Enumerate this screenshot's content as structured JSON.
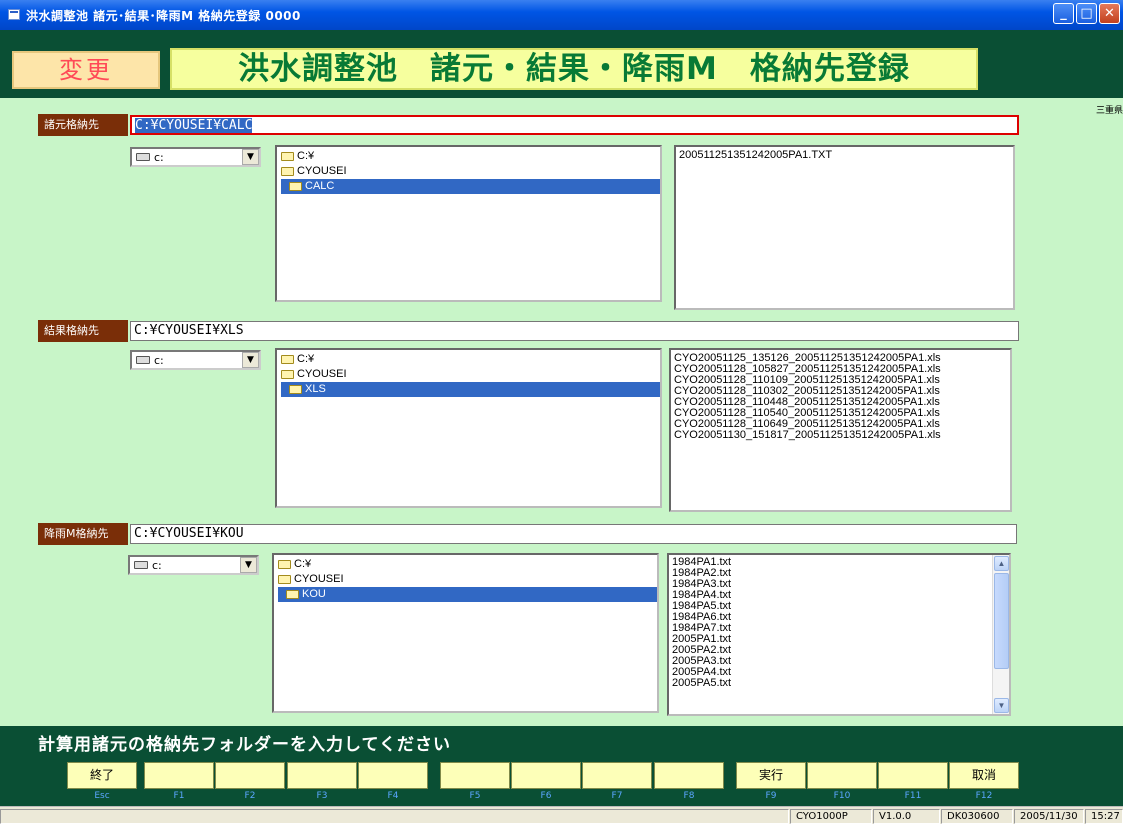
{
  "window": {
    "title": "洪水調整池 諸元･結果･降雨M 格納先登録 0000"
  },
  "header": {
    "mode": "変更",
    "title": "洪水調整池　諸元・結果・降雨M　格納先登録"
  },
  "region_label": "三重県",
  "sections": {
    "specs": {
      "label": "諸元格納先",
      "path": "C:¥CYOUSEI¥CALC",
      "drive": "c:",
      "tree": [
        "C:¥",
        "CYOUSEI",
        "CALC"
      ],
      "files": [
        "200511251351242005PA1.TXT"
      ]
    },
    "results": {
      "label": "結果格納先",
      "path": "C:¥CYOUSEI¥XLS",
      "drive": "c:",
      "tree": [
        "C:¥",
        "CYOUSEI",
        "XLS"
      ],
      "files": [
        "CYO20051125_135126_200511251351242005PA1.xls",
        "CYO20051128_105827_200511251351242005PA1.xls",
        "CYO20051128_110109_200511251351242005PA1.xls",
        "CYO20051128_110302_200511251351242005PA1.xls",
        "CYO20051128_110448_200511251351242005PA1.xls",
        "CYO20051128_110540_200511251351242005PA1.xls",
        "CYO20051128_110649_200511251351242005PA1.xls",
        "CYO20051130_151817_200511251351242005PA1.xls"
      ]
    },
    "rain": {
      "label": "降雨M格納先",
      "path": "C:¥CYOUSEI¥KOU",
      "drive": "c:",
      "tree": [
        "C:¥",
        "CYOUSEI",
        "KOU"
      ],
      "files": [
        "1984PA1.txt",
        "1984PA2.txt",
        "1984PA3.txt",
        "1984PA4.txt",
        "1984PA5.txt",
        "1984PA6.txt",
        "1984PA7.txt",
        "2005PA1.txt",
        "2005PA2.txt",
        "2005PA3.txt",
        "2005PA4.txt",
        "2005PA5.txt"
      ]
    }
  },
  "message": "計算用諸元の格納先フォルダーを入力してください",
  "function_keys": [
    {
      "label": "終了",
      "key": "Esc"
    },
    {
      "label": "",
      "key": "F1"
    },
    {
      "label": "",
      "key": "F2"
    },
    {
      "label": "",
      "key": "F3"
    },
    {
      "label": "",
      "key": "F4"
    },
    {
      "label": "",
      "key": "F5"
    },
    {
      "label": "",
      "key": "F6"
    },
    {
      "label": "",
      "key": "F7"
    },
    {
      "label": "",
      "key": "F8"
    },
    {
      "label": "実行",
      "key": "F9"
    },
    {
      "label": "",
      "key": "F10"
    },
    {
      "label": "",
      "key": "F11"
    },
    {
      "label": "取消",
      "key": "F12"
    }
  ],
  "status_bar": {
    "program_id": "CYO1000P",
    "version": "V1.0.0",
    "code": "DK030600",
    "date": "2005/11/30",
    "time": "15:27"
  }
}
